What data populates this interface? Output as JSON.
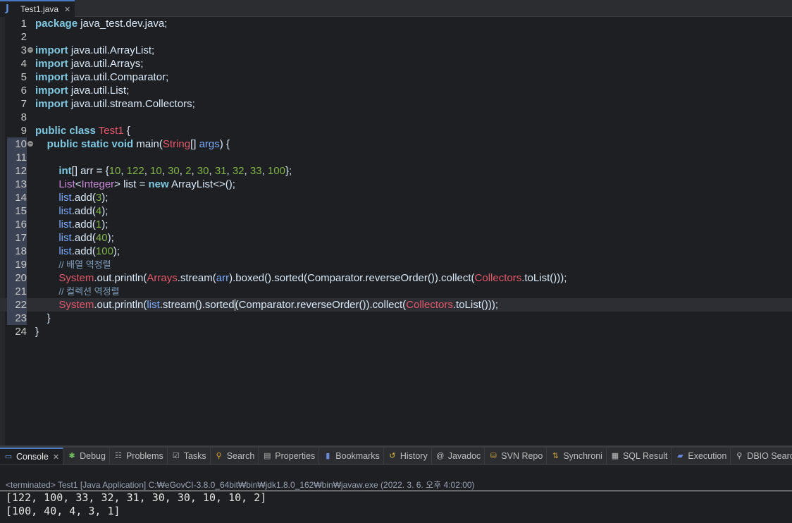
{
  "editor": {
    "tab_title": "Test1.java",
    "tab_icon": "J",
    "lines": [
      {
        "n": "1"
      },
      {
        "n": "2"
      },
      {
        "n": "3"
      },
      {
        "n": "4"
      },
      {
        "n": "5"
      },
      {
        "n": "6"
      },
      {
        "n": "7"
      },
      {
        "n": "8"
      },
      {
        "n": "9"
      },
      {
        "n": "10"
      },
      {
        "n": "11"
      },
      {
        "n": "12"
      },
      {
        "n": "13"
      },
      {
        "n": "14"
      },
      {
        "n": "15"
      },
      {
        "n": "16"
      },
      {
        "n": "17"
      },
      {
        "n": "18"
      },
      {
        "n": "19"
      },
      {
        "n": "20"
      },
      {
        "n": "21"
      },
      {
        "n": "22"
      },
      {
        "n": "23"
      },
      {
        "n": "24"
      }
    ],
    "code": {
      "l1_kw": "package",
      "l1_rest": " java_test.dev.java;",
      "l3_kw": "import",
      "l3_rest": " java.util.ArrayList;",
      "l4_kw": "import",
      "l4_rest": " java.util.Arrays;",
      "l5_kw": "import",
      "l5_rest": " java.util.Comparator;",
      "l6_kw": "import",
      "l6_rest": " java.util.List;",
      "l7_kw": "import",
      "l7_rest": " java.util.stream.Collectors;",
      "l9_kw": "public class",
      "l9_cls": "Test1",
      "l9_rest": " {",
      "l10_kw": "public static void",
      "l10_fn": " main(",
      "l10_type": "String",
      "l10_mid": "[] ",
      "l10_var": "args",
      "l10_rest": ") {",
      "l12_kw": "int",
      "l12_a": "[] arr = {",
      "l12_nums": [
        "10",
        "122",
        "10",
        "30",
        "2",
        "30",
        "31",
        "32",
        "33",
        "100"
      ],
      "l12_end": "};",
      "l13_type1": "List",
      "l13_lt": "<",
      "l13_type2": "Integer",
      "l13_mid": "> list = ",
      "l13_kw": "new",
      "l13_rest": " ArrayList<>();",
      "l14_var": "list",
      "l14_fn": ".add(",
      "l14_num": "3",
      "l14_end": ");",
      "l15_var": "list",
      "l15_fn": ".add(",
      "l15_num": "4",
      "l15_end": ");",
      "l16_var": "list",
      "l16_fn": ".add(",
      "l16_num": "1",
      "l16_end": ");",
      "l17_var": "list",
      "l17_fn": ".add(",
      "l17_num": "40",
      "l17_end": ");",
      "l18_var": "list",
      "l18_fn": ".add(",
      "l18_num": "100",
      "l18_end": ");",
      "l19_cmt": "// 배열 역정렬",
      "l20_cls": "System",
      "l20_out": ".out.println(",
      "l20_cls2": "Arrays",
      "l20_a": ".stream(",
      "l20_var": "arr",
      "l20_b": ").boxed().sorted(Comparator.reverseOrder()).collect(",
      "l20_cls3": "Collectors",
      "l20_c": ".toList()));",
      "l21_cmt": "// 컬렉션 역정렬",
      "l22_cls": "System",
      "l22_out": ".out.println(",
      "l22_var": "list",
      "l22_a": ".stream().sorted",
      "l22_b": "(Comparator.reverseOrder()).collect(",
      "l22_cls3": "Collectors",
      "l22_c": ".toList()));",
      "l23": "}",
      "l24": "}"
    }
  },
  "console": {
    "tabs": [
      {
        "label": "Console",
        "icon": "console-icon"
      },
      {
        "label": "Debug",
        "icon": "bug-icon"
      },
      {
        "label": "Problems",
        "icon": "problems-icon"
      },
      {
        "label": "Tasks",
        "icon": "tasks-icon"
      },
      {
        "label": "Search",
        "icon": "search-icon"
      },
      {
        "label": "Properties",
        "icon": "properties-icon"
      },
      {
        "label": "Bookmarks",
        "icon": "bookmark-icon"
      },
      {
        "label": "History",
        "icon": "history-icon"
      },
      {
        "label": "Javadoc",
        "icon": "at-icon"
      },
      {
        "label": "SVN Repo",
        "icon": "svn-icon"
      },
      {
        "label": "Synchroni",
        "icon": "sync-icon"
      },
      {
        "label": "SQL Result",
        "icon": "table-icon"
      },
      {
        "label": "Execution",
        "icon": "execution-icon"
      },
      {
        "label": "DBIO Searc",
        "icon": "dbio-icon"
      }
    ],
    "status": "<terminated> Test1 [Java Application] C:₩eGovCI-3.8.0_64bit₩bin₩jdk1.8.0_162₩bin₩javaw.exe (2022. 3. 6. 오후 4:02:00)",
    "output": [
      "[122, 100, 33, 32, 31, 30, 30, 10, 10, 2]",
      "[100, 40, 4, 3, 1]"
    ]
  }
}
